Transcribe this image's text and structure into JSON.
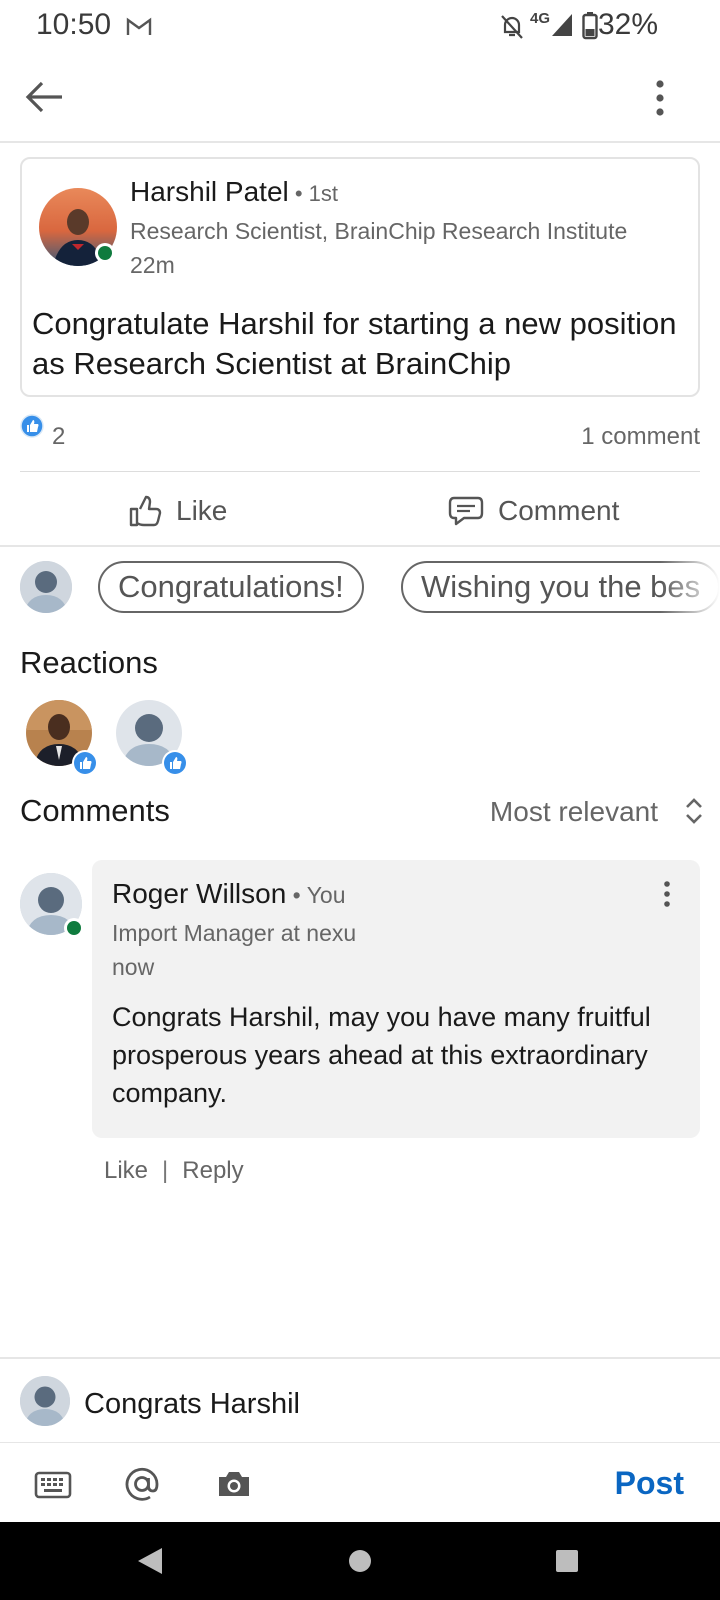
{
  "status_bar": {
    "time": "10:50",
    "network": "4G",
    "battery": "32%",
    "icons": [
      "gmail-icon",
      "bell-off-icon",
      "signal-icon",
      "battery-icon"
    ]
  },
  "app_bar": {
    "back_icon": "back-arrow-icon",
    "overflow_icon": "more-vertical-icon"
  },
  "post": {
    "author_name": "Harshil Patel",
    "degree": " • 1st",
    "headline": "Research Scientist, BrainChip Research Institute",
    "time": "22m",
    "text": "Congratulate Harshil for starting a new position as Research Scientist at BrainChip",
    "like_count": "2",
    "comment_count": "1 comment",
    "actions": {
      "like": "Like",
      "comment": "Comment"
    }
  },
  "quick_replies": [
    "Congratulations!",
    "Wishing you the bes"
  ],
  "reactions": {
    "title": "Reactions"
  },
  "comments": {
    "title": "Comments",
    "sort": "Most relevant",
    "items": [
      {
        "name": "Roger Willson",
        "you": " • You",
        "headline": "Import Manager at nexu",
        "time": "now",
        "text": "Congrats Harshil, may you have many fruitful prosperous years ahead at this extraordinary company.",
        "like": "Like",
        "separator": "|",
        "reply": "Reply"
      }
    ]
  },
  "composer": {
    "value": "Congrats Harshil",
    "post": "Post",
    "tools": [
      "keyboard-icon",
      "at-sign-icon",
      "camera-icon"
    ]
  },
  "colors": {
    "accent": "#0a66c2",
    "online": "#0f7b3e",
    "bubble": "#f2f2f2"
  }
}
